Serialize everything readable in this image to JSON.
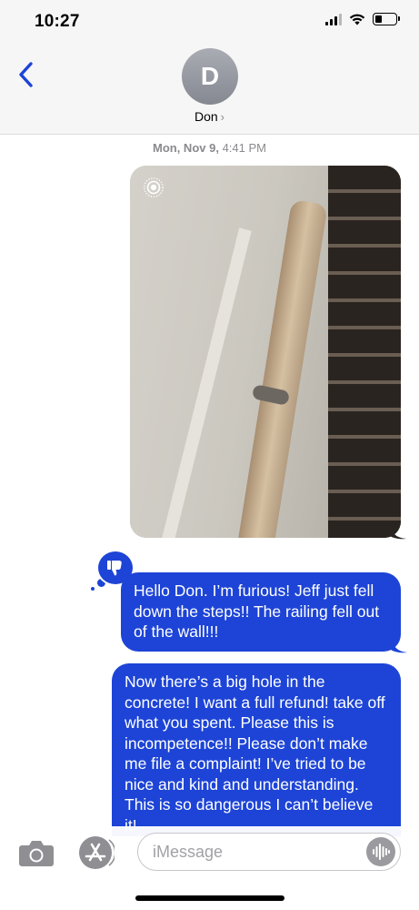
{
  "status_bar": {
    "time": "10:27",
    "icons": [
      "signal-icon",
      "wifi-icon",
      "battery-icon"
    ],
    "battery_level": 0.35
  },
  "header": {
    "avatar_initial": "D",
    "contact_name": "Don",
    "chevron": "›"
  },
  "conversation": {
    "timestamp_day": "Mon, Nov 9,",
    "timestamp_time": "4:41 PM",
    "photo_message": {
      "icon": "live-photo-icon"
    },
    "tapback": {
      "icon": "thumbs-down-icon"
    },
    "messages": [
      {
        "text": "Hello Don. I’m furious! Jeff just fell down the steps!! The railing fell out of the wall!!!"
      },
      {
        "text": "Now there’s a big hole in the concrete!  I want a full refund! take off what you spent. Please this is incompetence!! Please don’t make me file a complaint! I’ve tried to be nice and kind and understanding. This is so dangerous I can’t believe it!"
      }
    ]
  },
  "composer": {
    "placeholder": "iMessage",
    "icons": [
      "camera-icon",
      "app-store-icon",
      "audio-waveform-icon"
    ]
  },
  "colors": {
    "accent": "#1d44d6",
    "back_chevron": "#1d44d6",
    "header_bg": "#f6f6f7"
  }
}
